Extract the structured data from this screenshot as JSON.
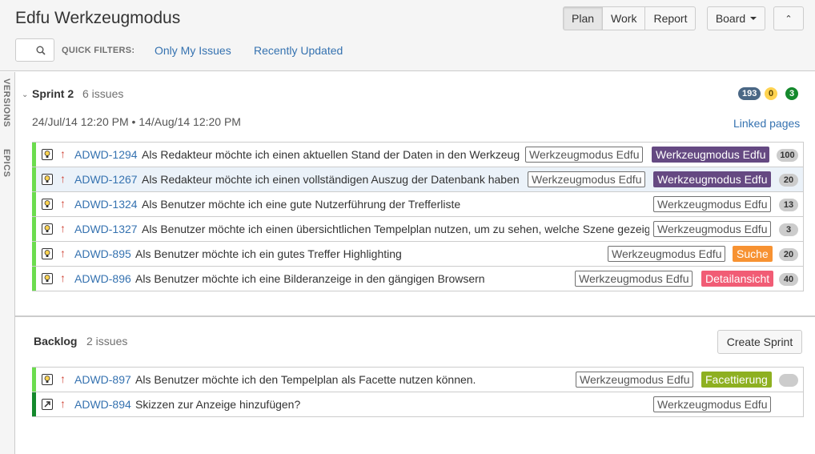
{
  "header": {
    "title": "Edfu Werkzeugmodus",
    "modes": [
      "Plan",
      "Work",
      "Report"
    ],
    "board_label": "Board",
    "collapse_glyph": "⌃",
    "quick_filters_label": "QUICK FILTERS:",
    "quick_filters": [
      "Only My Issues",
      "Recently Updated"
    ]
  },
  "rail": {
    "versions": "VERSIONS",
    "epics": "EPICS"
  },
  "sprint": {
    "name": "Sprint 2",
    "count": "6 issues",
    "badges": {
      "todo": "193",
      "in_progress": "0",
      "done": "3"
    },
    "dates": "24/Jul/14 12:20 PM • 14/Aug/14 12:20 PM",
    "linked_pages": "Linked pages",
    "issues": [
      {
        "key": "ADWD-1294",
        "summary": "Als Redakteur möchte ich einen aktuellen Stand der Daten in den Werkzeugmodus laden",
        "version": "Werkzeugmodus Edfu",
        "epic": "Werkzeugmodus Edfu",
        "epic_color": "#654982",
        "estimate": "100"
      },
      {
        "key": "ADWD-1267",
        "summary": "Als Redakteur möchte ich einen vollständigen Auszug der Datenbank haben",
        "version": "Werkzeugmodus Edfu",
        "epic": "Werkzeugmodus Edfu",
        "epic_color": "#654982",
        "estimate": "20"
      },
      {
        "key": "ADWD-1324",
        "summary": "Als Benutzer möchte ich eine gute Nutzerführung der Trefferliste",
        "version": "Werkzeugmodus Edfu",
        "epic": "",
        "epic_color": "",
        "estimate": "13"
      },
      {
        "key": "ADWD-1327",
        "summary": "Als Benutzer möchte ich einen übersichtlichen Tempelplan nutzen, um zu sehen, welche Szene gezeigt wird",
        "version": "Werkzeugmodus Edfu",
        "epic": "",
        "epic_color": "",
        "estimate": "3"
      },
      {
        "key": "ADWD-895",
        "summary": "Als Benutzer möchte ich ein gutes Treffer Highlighting",
        "version": "Werkzeugmodus Edfu",
        "epic": "Suche",
        "epic_color": "#f79232",
        "estimate": "20"
      },
      {
        "key": "ADWD-896",
        "summary": "Als Benutzer möchte ich eine Bilderanzeige in den gängigen Browsern",
        "version": "Werkzeugmodus Edfu",
        "epic": "Detailansicht",
        "epic_color": "#f15c75",
        "estimate": "40"
      }
    ]
  },
  "backlog": {
    "name": "Backlog",
    "count": "2 issues",
    "create_sprint": "Create Sprint",
    "issues": [
      {
        "key": "ADWD-897",
        "summary": "Als Benutzer möchte ich den Tempelplan als Facette nutzen können.",
        "version": "Werkzeugmodus Edfu",
        "epic": "Facettierung",
        "epic_color": "#8eb021",
        "estimate": ""
      },
      {
        "key": "ADWD-894",
        "summary": "Skizzen zur Anzeige hinzufügen?",
        "version": "Werkzeugmodus Edfu",
        "epic": "",
        "epic_color": "",
        "estimate": ""
      }
    ]
  }
}
